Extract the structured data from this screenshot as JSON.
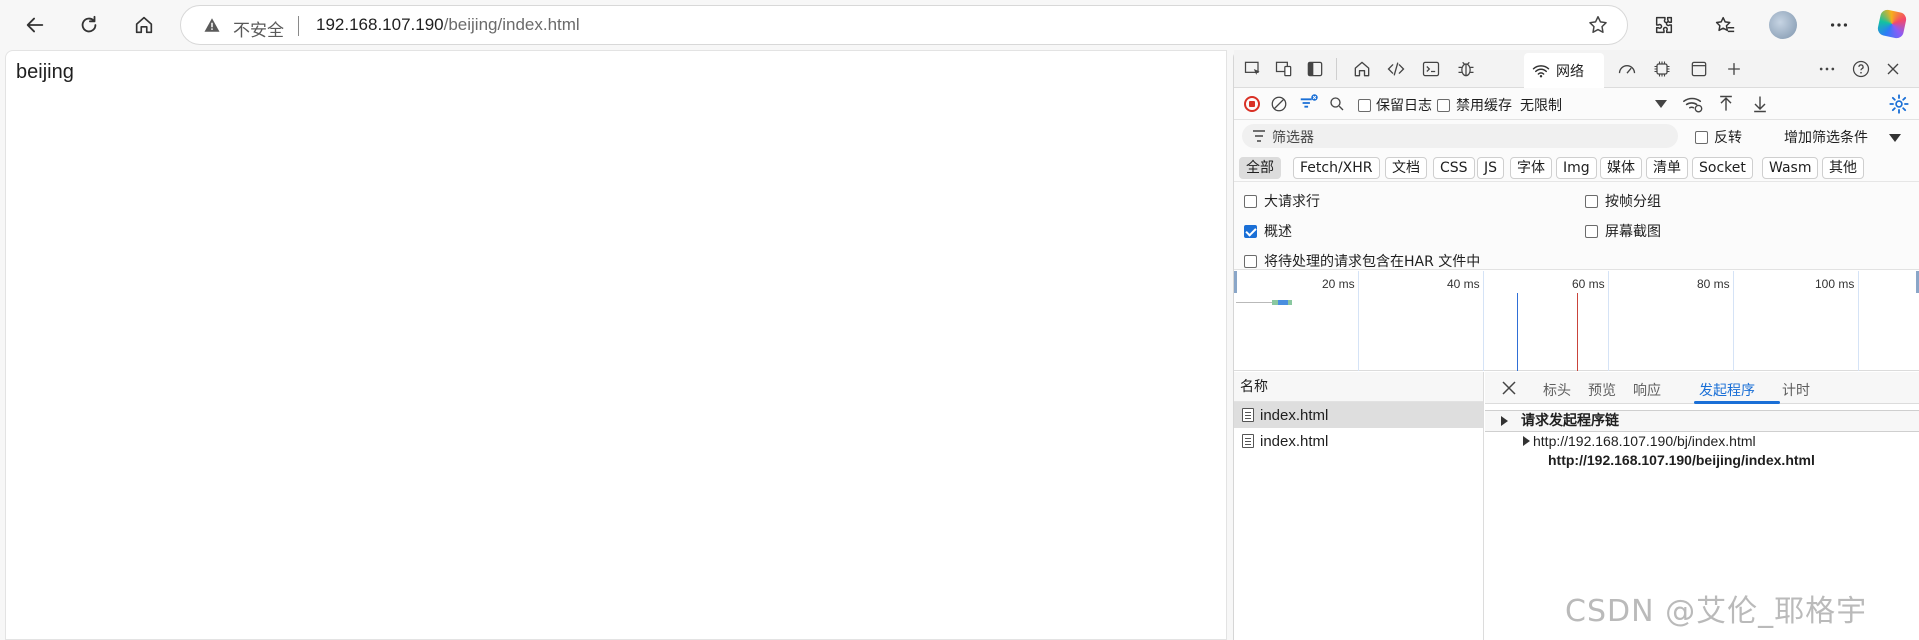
{
  "browser": {
    "security_label": "不安全",
    "url_host": "192.168.107.190",
    "url_path": "/beijing/index.html"
  },
  "page": {
    "text": "beijing"
  },
  "devtools": {
    "network_tab_label": "网络",
    "toolbar": {
      "preserve_log_label": "保留日志",
      "disable_cache_label": "禁用缓存",
      "throttle_label": "无限制"
    },
    "filter": {
      "placeholder": "筛选器",
      "invert_label": "反转",
      "more_filters_label": "增加筛选条件"
    },
    "type_filters": [
      "全部",
      "Fetch/XHR",
      "文档",
      "CSS",
      "JS",
      "字体",
      "Img",
      "媒体",
      "清单",
      "Socket",
      "Wasm",
      "其他"
    ],
    "options": {
      "big_rows_label": "大请求行",
      "group_by_frame_label": "按帧分组",
      "overview_label": "概述",
      "screenshots_label": "屏幕截图",
      "har_pending_label": "将待处理的请求包含在HAR 文件中",
      "overview_checked": true
    },
    "timeline_ticks": [
      "20 ms",
      "40 ms",
      "60 ms",
      "80 ms",
      "100 ms"
    ],
    "request_list": {
      "header": "名称",
      "rows": [
        "index.html",
        "index.html"
      ]
    },
    "detail": {
      "tabs": [
        "标头",
        "预览",
        "响应",
        "发起程序",
        "计时"
      ],
      "active_tab": "发起程序",
      "chain_title": "请求发起程序链",
      "chain_parent": "http://192.168.107.190/bj/index.html",
      "chain_child": "http://192.168.107.190/beijing/index.html"
    }
  },
  "watermark": "CSDN @艾伦_耶格宇"
}
